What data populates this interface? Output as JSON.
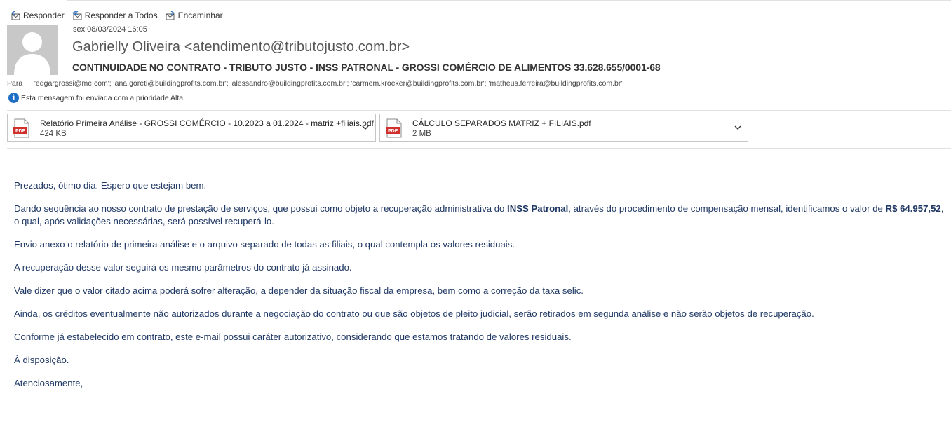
{
  "toolbar": {
    "reply": "Responder",
    "reply_all": "Responder a Todos",
    "forward": "Encaminhar"
  },
  "message": {
    "date": "sex 08/03/2024 16:05",
    "sender": "Gabrielly Oliveira <atendimento@tributojusto.com.br>",
    "subject": "CONTINUIDADE NO CONTRATO - TRIBUTO JUSTO - INSS PATRONAL - GROSSI COMÉRCIO DE ALIMENTOS  33.628.655/0001-68",
    "to_label": "Para",
    "to": "'edgargrossi@me.com'; 'ana.goreti@buildingprofits.com.br'; 'alessandro@buildingprofits.com.br'; 'carmem.kroeker@buildingprofits.com.br'; 'matheus.ferreira@buildingprofits.com.br'",
    "priority_notice": "Esta mensagem foi enviada com a prioridade Alta."
  },
  "attachments": [
    {
      "name": "Relatório Primeira Análise - GROSSI COMÉRCIO - 10.2023 a 01.2024 - matriz +filiais.pdf",
      "size": "424 KB",
      "icon": "pdf-icon"
    },
    {
      "name": "CÁLCULO SEPARADOS MATRIZ + FILIAIS.pdf",
      "size": "2 MB",
      "icon": "pdf-icon"
    }
  ],
  "body": {
    "greeting": "Prezados, ótimo dia. Espero que estejam bem.",
    "p1_a": "Dando sequência ao nosso contrato de prestação de serviços, que possui como objeto a recuperação administrativa do ",
    "p1_bold1": "INSS Patronal",
    "p1_b": ", através do procedimento de compensação mensal, identificamos o valor de ",
    "p1_bold2": "R$ 64.957,52",
    "p1_c": ", o qual, após validações necessárias, será possível recuperá-lo.",
    "p2": "Envio anexo o relatório de primeira análise e o arquivo separado de todas as filiais, o qual contempla os valores residuais.",
    "p3": "A recuperação desse valor seguirá os mesmo parâmetros do contrato já assinado.",
    "p4": "Vale dizer que o valor citado acima poderá sofrer alteração, a depender da situação fiscal da empresa, bem como a correção da taxa selic.",
    "p5": "Ainda, os créditos eventualmente não autorizados durante a negociação do contrato ou que são objetos de pleito judicial, serão retirados em segunda análise e não serão objetos de recuperação.",
    "p6": "Conforme já estabelecido em contrato, este e-mail possui caráter autorizativo, considerando que estamos tratando de valores residuais.",
    "p7": "À disposição.",
    "closing": "Atenciosamente,"
  },
  "colors": {
    "body_text": "#1f3864",
    "pdf_red": "#d0312d",
    "info_blue": "#1e6fc3"
  }
}
